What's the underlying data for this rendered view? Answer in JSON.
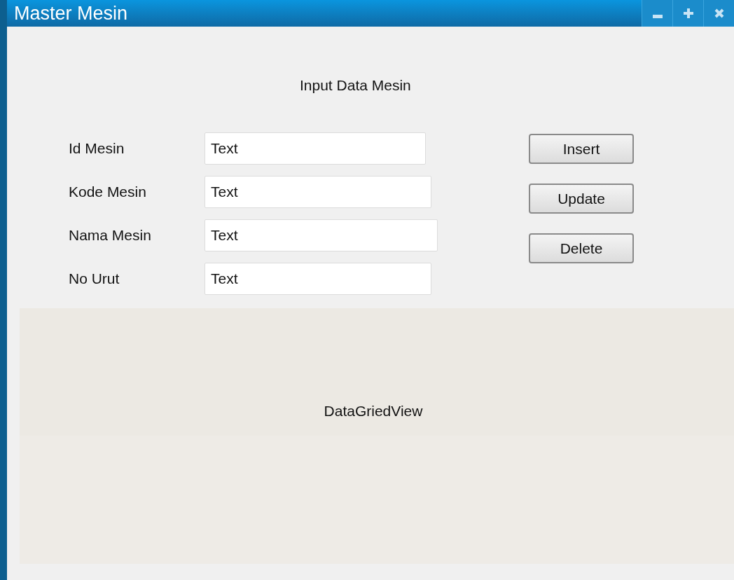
{
  "window": {
    "title": "Master Mesin",
    "controls": [
      {
        "kind": "minimize"
      },
      {
        "kind": "maximize"
      },
      {
        "kind": "close"
      }
    ]
  },
  "form": {
    "heading": "Input Data Mesin",
    "fields": [
      {
        "label": "Id Mesin",
        "value": "Text"
      },
      {
        "label": "Kode Mesin",
        "value": "Text"
      },
      {
        "label": "Nama Mesin",
        "value": "Text"
      },
      {
        "label": "No Urut",
        "value": "Text"
      }
    ],
    "buttons": [
      "Insert",
      "Update",
      "Delete"
    ]
  },
  "grid": {
    "label": "DataGriedView"
  }
}
